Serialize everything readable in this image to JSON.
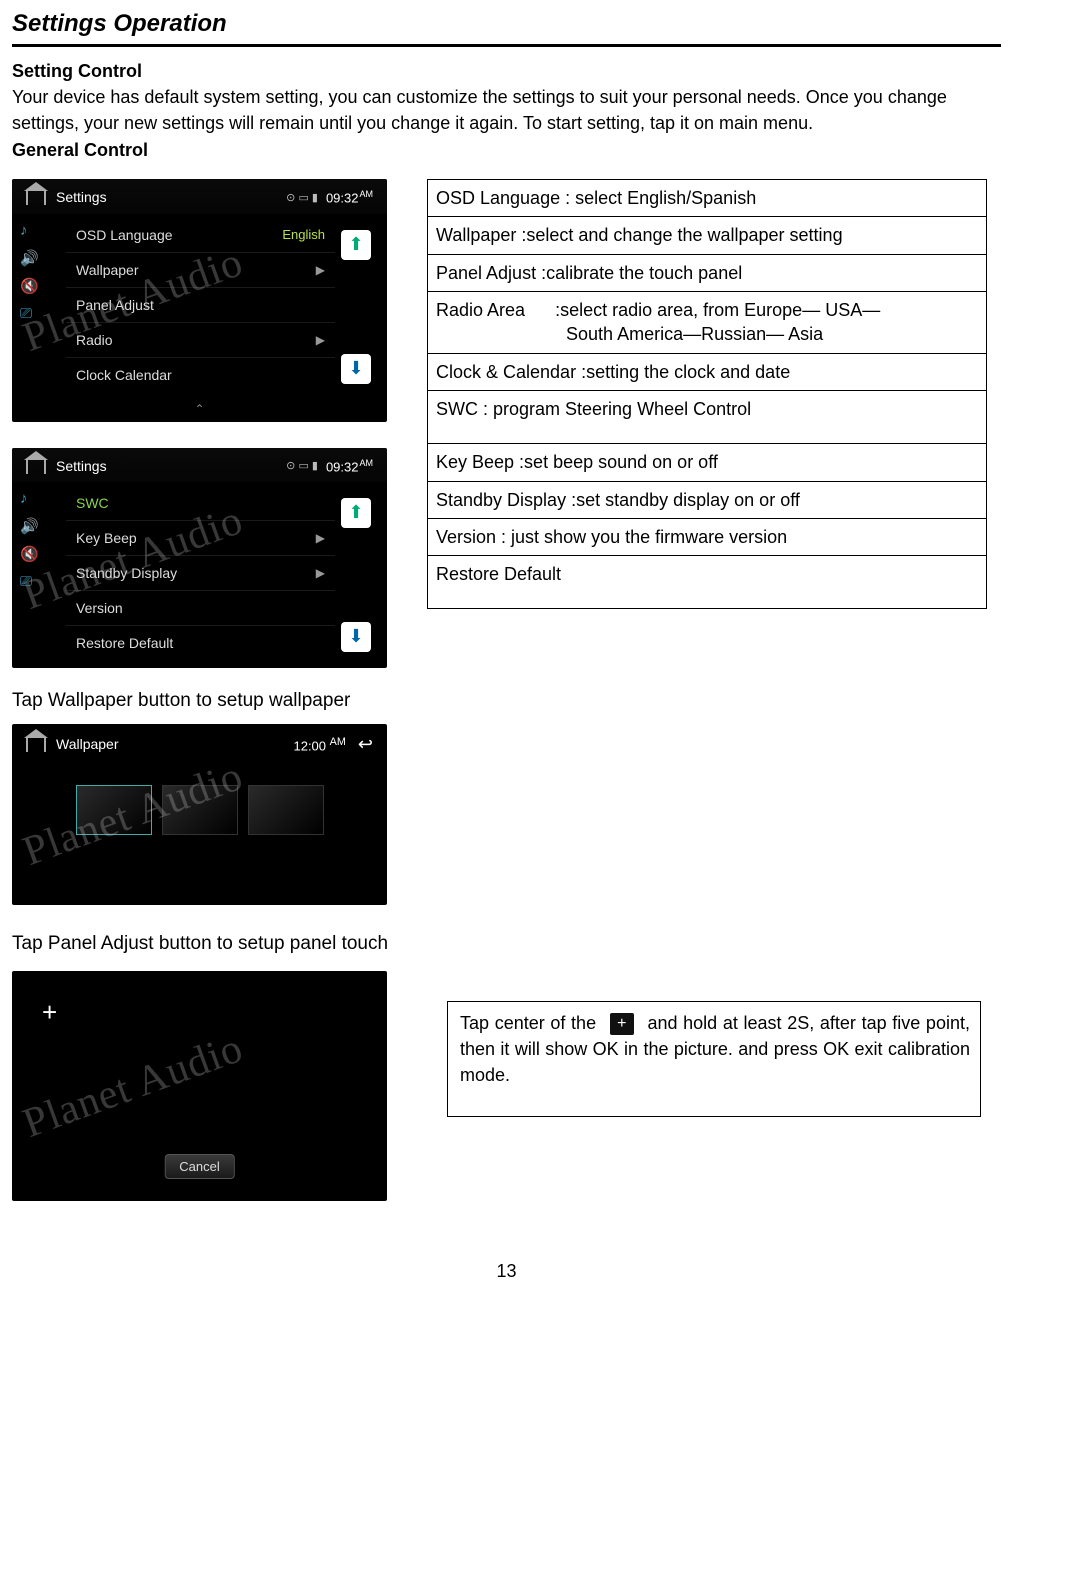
{
  "page": {
    "title": "Settings Operation",
    "setting_control_heading": "Setting Control",
    "intro": "Your device has default system setting, you can customize the settings to suit your personal needs. Once you change settings, your new settings will remain until you change it again. To start setting, tap it on main menu.",
    "general_control_heading": "General Control",
    "wallpaper_note": "Tap Wallpaper button to setup wallpaper",
    "panel_adjust_note": "Tap Panel Adjust button to setup panel touch",
    "page_number": "13"
  },
  "screenshot1": {
    "title": "Settings",
    "time": "09:32",
    "ampm": "AM",
    "rows": [
      {
        "label": "OSD Language",
        "value": "English"
      },
      {
        "label": "Wallpaper",
        "value": "▶"
      },
      {
        "label": "Panel Adjust",
        "value": ""
      },
      {
        "label": "Radio",
        "value": "▶"
      },
      {
        "label": "Clock Calendar",
        "value": ""
      }
    ],
    "watermark": "Planet Audio"
  },
  "screenshot2": {
    "title": "Settings",
    "time": "09:32",
    "ampm": "AM",
    "rows": [
      {
        "label": "SWC",
        "value": "",
        "green": true
      },
      {
        "label": "Key Beep",
        "value": "▶"
      },
      {
        "label": "Standby Display",
        "value": "▶"
      },
      {
        "label": "Version",
        "value": ""
      },
      {
        "label": "Restore Default",
        "value": ""
      }
    ],
    "watermark": "Planet Audio"
  },
  "desc_table": [
    "OSD Language : select English/Spanish",
    "Wallpaper       :select and change the wallpaper setting",
    "Panel Adjust    :calibrate the touch panel",
    "Radio Area      :select radio area, from Europe— USA—\n                          South America—Russian— Asia",
    "Clock & Calendar :setting the clock and date",
    "SWC                   : program Steering Wheel Control",
    "Key Beep        :set beep sound on or off",
    "Standby Display :set standby display on or off",
    "Version            : just show you the firmware version",
    "Restore Default"
  ],
  "wallpaper_screen": {
    "title": "Wallpaper",
    "time": "12:00",
    "ampm": "AM",
    "watermark": "Planet Audio"
  },
  "panel_adjust_screen": {
    "cancel": "Cancel",
    "watermark": "Planet Audio"
  },
  "tap_box": {
    "part1": "Tap center of the",
    "part2": "and hold at least 2S, after tap   five   point,           then  it  will  show  OK  in  the picture. and press OK exit calibration mode."
  }
}
